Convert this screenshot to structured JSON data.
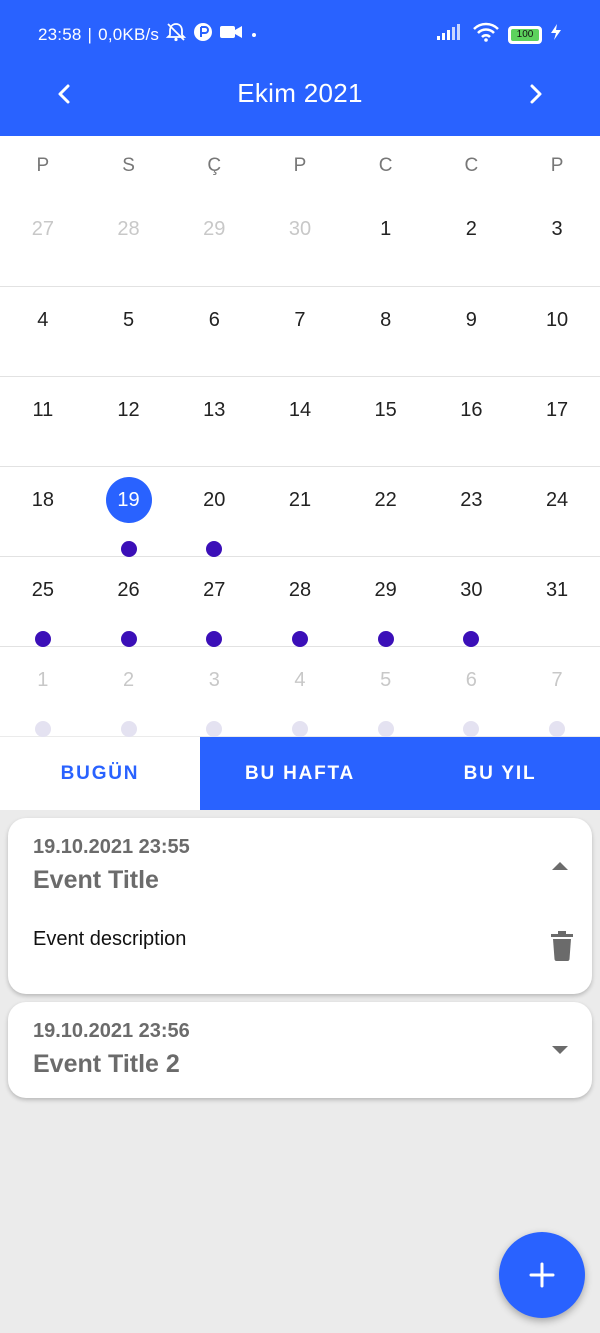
{
  "status_bar": {
    "time": "23:58",
    "network_speed": "0,0KB/s",
    "separator": "|",
    "battery_level": "100",
    "icons": [
      "muted-bell-icon",
      "p-circle-icon",
      "video-camera-icon",
      "dot-icon",
      "signal-icon",
      "wifi-icon",
      "battery-icon",
      "charging-icon"
    ]
  },
  "header": {
    "month_year": "Ekim  2021",
    "prev_icon": "chevron-left-icon",
    "next_icon": "chevron-right-icon",
    "color": "#2962ff"
  },
  "calendar": {
    "weekdays": [
      "P",
      "S",
      "Ç",
      "P",
      "C",
      "C",
      "P"
    ],
    "weeks": [
      {
        "days": [
          {
            "day": "27",
            "faded": true,
            "dot": false
          },
          {
            "day": "28",
            "faded": true,
            "dot": false
          },
          {
            "day": "29",
            "faded": true,
            "dot": false
          },
          {
            "day": "30",
            "faded": true,
            "dot": false
          },
          {
            "day": "1",
            "faded": false,
            "dot": false
          },
          {
            "day": "2",
            "faded": false,
            "dot": false
          },
          {
            "day": "3",
            "faded": false,
            "dot": false
          }
        ]
      },
      {
        "days": [
          {
            "day": "4",
            "faded": false,
            "dot": false
          },
          {
            "day": "5",
            "faded": false,
            "dot": false
          },
          {
            "day": "6",
            "faded": false,
            "dot": false
          },
          {
            "day": "7",
            "faded": false,
            "dot": false
          },
          {
            "day": "8",
            "faded": false,
            "dot": false
          },
          {
            "day": "9",
            "faded": false,
            "dot": false
          },
          {
            "day": "10",
            "faded": false,
            "dot": false
          }
        ]
      },
      {
        "days": [
          {
            "day": "11",
            "faded": false,
            "dot": false
          },
          {
            "day": "12",
            "faded": false,
            "dot": false
          },
          {
            "day": "13",
            "faded": false,
            "dot": false
          },
          {
            "day": "14",
            "faded": false,
            "dot": false
          },
          {
            "day": "15",
            "faded": false,
            "dot": false
          },
          {
            "day": "16",
            "faded": false,
            "dot": false
          },
          {
            "day": "17",
            "faded": false,
            "dot": false
          }
        ]
      },
      {
        "days": [
          {
            "day": "18",
            "faded": false,
            "dot": false
          },
          {
            "day": "19",
            "faded": false,
            "dot": true,
            "selected": true
          },
          {
            "day": "20",
            "faded": false,
            "dot": true
          },
          {
            "day": "21",
            "faded": false,
            "dot": false
          },
          {
            "day": "22",
            "faded": false,
            "dot": false
          },
          {
            "day": "23",
            "faded": false,
            "dot": false
          },
          {
            "day": "24",
            "faded": false,
            "dot": false
          }
        ]
      },
      {
        "days": [
          {
            "day": "25",
            "faded": false,
            "dot": true
          },
          {
            "day": "26",
            "faded": false,
            "dot": true
          },
          {
            "day": "27",
            "faded": false,
            "dot": true
          },
          {
            "day": "28",
            "faded": false,
            "dot": true
          },
          {
            "day": "29",
            "faded": false,
            "dot": true
          },
          {
            "day": "30",
            "faded": false,
            "dot": true
          },
          {
            "day": "31",
            "faded": false,
            "dot": false
          }
        ]
      },
      {
        "days": [
          {
            "day": "1",
            "faded": true,
            "dot": true
          },
          {
            "day": "2",
            "faded": true,
            "dot": true
          },
          {
            "day": "3",
            "faded": true,
            "dot": true
          },
          {
            "day": "4",
            "faded": true,
            "dot": true
          },
          {
            "day": "5",
            "faded": true,
            "dot": true
          },
          {
            "day": "6",
            "faded": true,
            "dot": true
          },
          {
            "day": "7",
            "faded": true,
            "dot": true
          }
        ]
      }
    ],
    "selected_color": "#2962ff",
    "dot_color": "#3b0fb8"
  },
  "filters": {
    "tabs": [
      {
        "label": "BUGÜN",
        "active": false
      },
      {
        "label": "BU HAFTA",
        "active": true
      },
      {
        "label": "BU YIL",
        "active": true
      }
    ]
  },
  "events": [
    {
      "datetime": "19.10.2021 23:55",
      "title": "Event Title",
      "description": "Event description",
      "expanded": true,
      "toggle_icon": "caret-up-icon",
      "delete_icon": "trash-icon"
    },
    {
      "datetime": "19.10.2021 23:56",
      "title": "Event Title 2",
      "expanded": false,
      "toggle_icon": "caret-down-icon"
    }
  ],
  "fab": {
    "icon": "plus-icon"
  }
}
